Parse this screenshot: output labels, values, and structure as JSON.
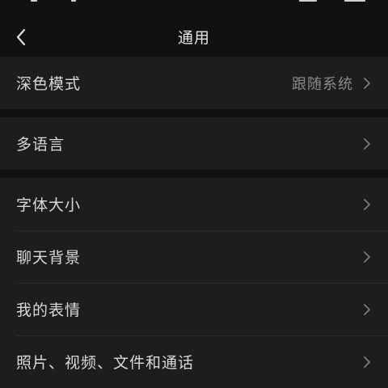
{
  "header": {
    "title": "通用"
  },
  "groups": [
    {
      "items": [
        {
          "label": "深色模式",
          "value": "跟随系统"
        }
      ]
    },
    {
      "items": [
        {
          "label": "多语言"
        }
      ]
    },
    {
      "items": [
        {
          "label": "字体大小"
        },
        {
          "label": "聊天背景"
        },
        {
          "label": "我的表情"
        },
        {
          "label": "照片、视频、文件和通话"
        }
      ]
    }
  ],
  "colors": {
    "background": "#111111",
    "cell": "#1d1d1d",
    "text": "#d8d8d8",
    "secondary_text": "#8a8a8a",
    "chevron": "#7a7a7a"
  },
  "icons": {
    "back": "chevron-left-icon",
    "row_arrow": "chevron-right-icon"
  }
}
